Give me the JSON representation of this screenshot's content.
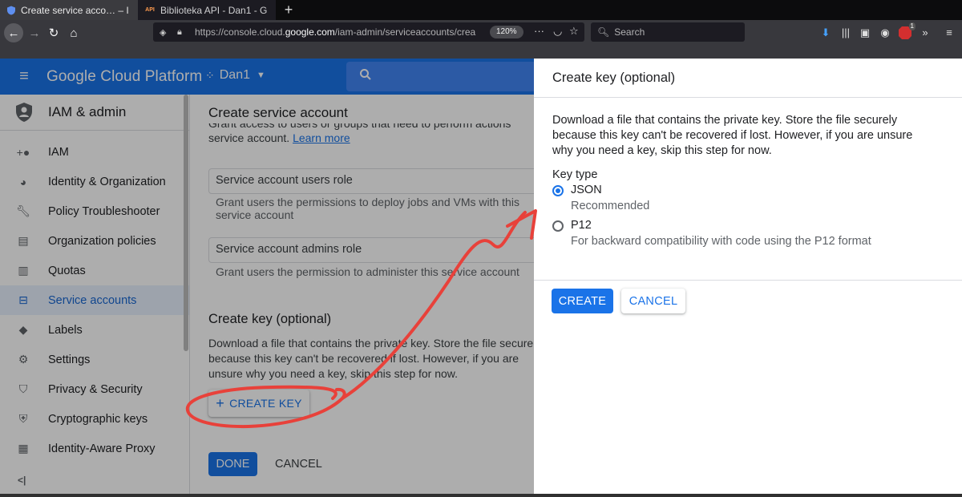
{
  "browser": {
    "tabs": [
      {
        "title": "Create service acco… – I",
        "active": true
      },
      {
        "title": "Biblioteka API - Dan1 - G",
        "active": false
      }
    ],
    "url": {
      "prefix": "https://console.cloud.",
      "domain": "google.com",
      "path": "/iam-admin/serviceaccounts/crea"
    },
    "zoom": "120%",
    "search_placeholder": "Search",
    "notification_badge": "1"
  },
  "gcp_header": {
    "title": "Google Cloud Platform",
    "project": "Dan1"
  },
  "sidebar": {
    "title": "IAM & admin",
    "items": [
      {
        "label": "IAM",
        "icon": "person-add-icon",
        "active": false
      },
      {
        "label": "Identity & Organization",
        "icon": "account-circle-icon",
        "active": false
      },
      {
        "label": "Policy Troubleshooter",
        "icon": "wrench-icon",
        "active": false
      },
      {
        "label": "Organization policies",
        "icon": "list-icon",
        "active": false
      },
      {
        "label": "Quotas",
        "icon": "quota-icon",
        "active": false
      },
      {
        "label": "Service accounts",
        "icon": "service-account-icon",
        "active": true
      },
      {
        "label": "Labels",
        "icon": "tag-icon",
        "active": false
      },
      {
        "label": "Settings",
        "icon": "gear-icon",
        "active": false
      },
      {
        "label": "Privacy & Security",
        "icon": "shield-icon",
        "active": false
      },
      {
        "label": "Cryptographic keys",
        "icon": "key-shield-icon",
        "active": false
      },
      {
        "label": "Identity-Aware Proxy",
        "icon": "proxy-icon",
        "active": false
      }
    ],
    "collapse_label": "<|"
  },
  "main": {
    "title": "Create service account",
    "grant_clipped": "Grant access to users or groups that need to perform actions",
    "grant_line2": "service account.",
    "learn_more": "Learn more",
    "users_role": {
      "label": "Service account users role",
      "help": "Grant users the permissions to deploy jobs and VMs with this service account"
    },
    "admins_role": {
      "label": "Service account admins role",
      "help": "Grant users the permission to administer this service account"
    },
    "create_key_heading": "Create key (optional)",
    "create_key_desc": "Download a file that contains the private key. Store the file securely because this key can't be recovered if lost. However, if you are unsure why you need a key, skip this step for now.",
    "create_key_button": "CREATE KEY",
    "done_button": "DONE",
    "cancel_button": "CANCEL"
  },
  "panel": {
    "title": "Create key (optional)",
    "description": "Download a file that contains the private key. Store the file securely because this key can't be recovered if lost. However, if you are unsure why you need a key, skip this step for now.",
    "key_type_label": "Key type",
    "options": [
      {
        "label": "JSON",
        "sub": "Recommended",
        "checked": true
      },
      {
        "label": "P12",
        "sub": "For backward compatibility with code using the P12 format",
        "checked": false
      }
    ],
    "create_button": "CREATE",
    "cancel_button": "CANCEL"
  },
  "colors": {
    "accent": "#1a73e8",
    "header": "#1a73e8",
    "annotation": "#e8413a"
  }
}
